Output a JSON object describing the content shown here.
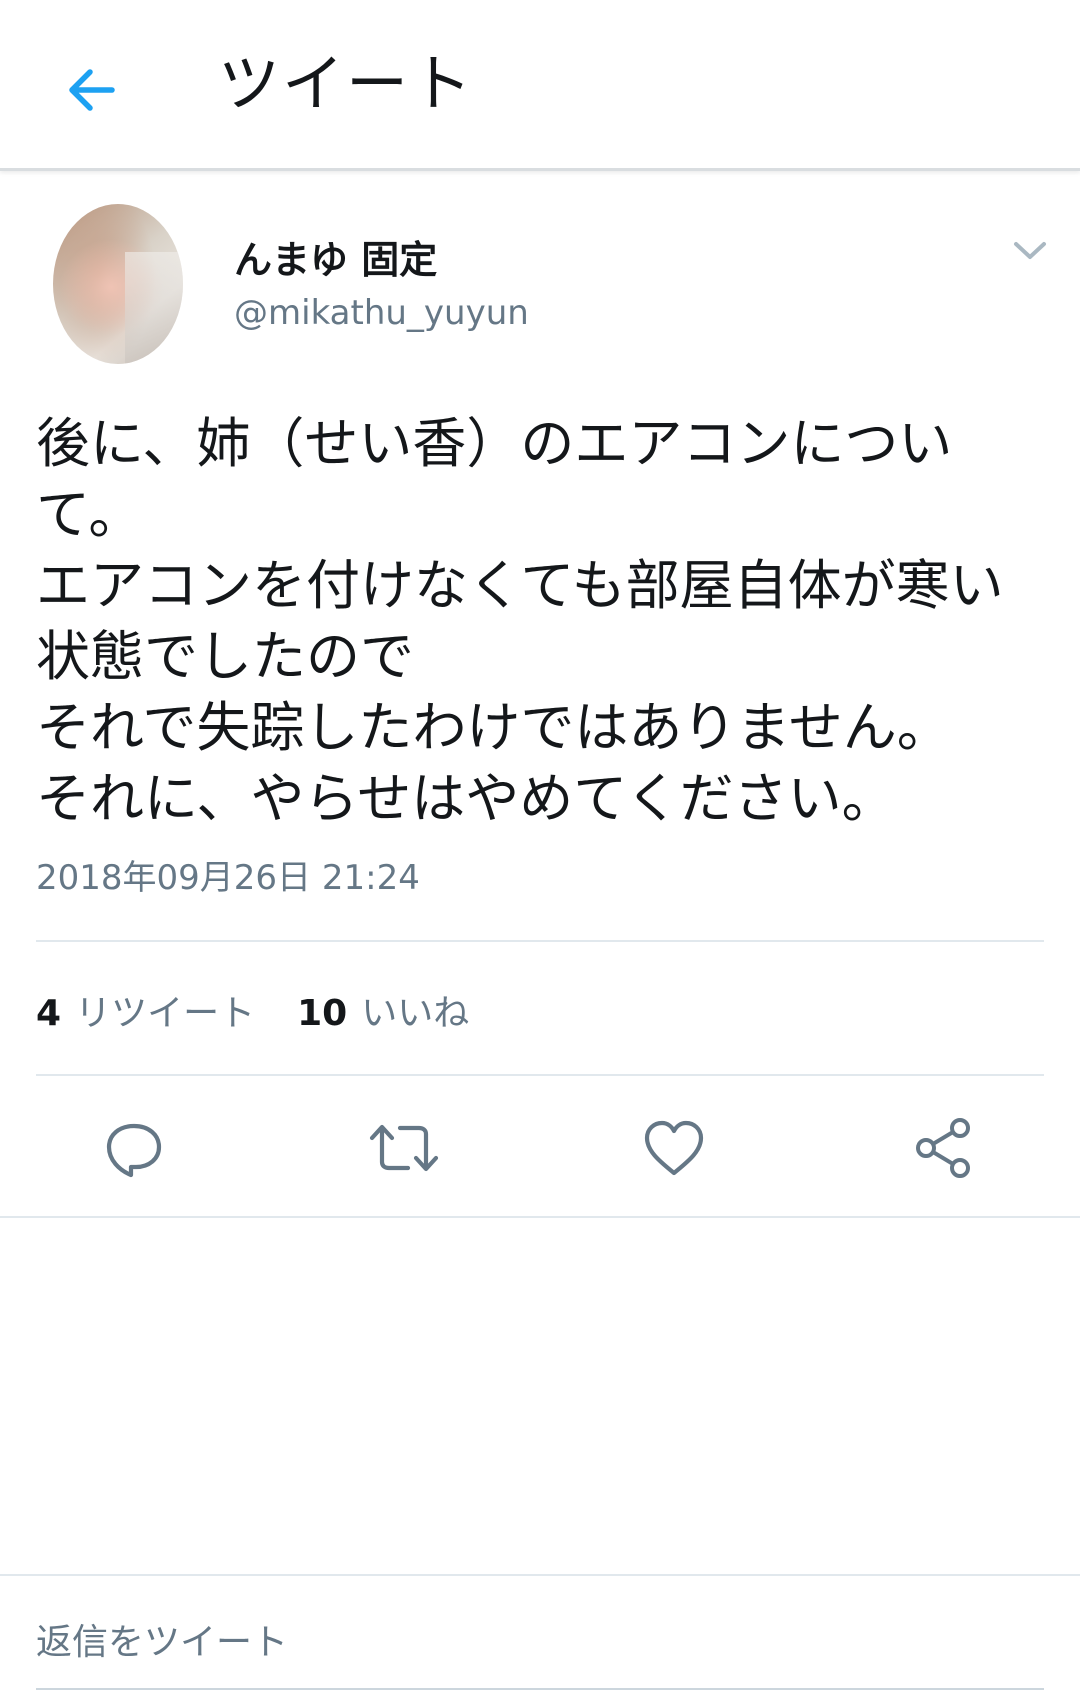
{
  "header": {
    "back_icon": "arrow-left-icon",
    "title": "ツイート"
  },
  "tweet": {
    "display_name": "んまゆ 固定",
    "handle": "@mikathu_yuyun",
    "text": "後に、姉（せい香）のエアコンについ\nて。\nエアコンを付けなくても部屋自体が寒い\n状態でしたので\nそれで失踪したわけではありません。\nそれに、やらせはやめてください。",
    "timestamp": "2018年09月26日 21:24"
  },
  "stats": {
    "retweet_count": "4",
    "retweet_label": "リツイート",
    "like_count": "10",
    "like_label": "いいね"
  },
  "actions": {
    "icons": [
      "reply-icon",
      "retweet-icon",
      "heart-icon",
      "share-icon"
    ]
  },
  "reply": {
    "placeholder": "返信をツイート"
  },
  "colors": {
    "accent": "#1da1f2",
    "text": "#14171a",
    "secondary": "#657786",
    "divider": "#e1e8ed"
  }
}
